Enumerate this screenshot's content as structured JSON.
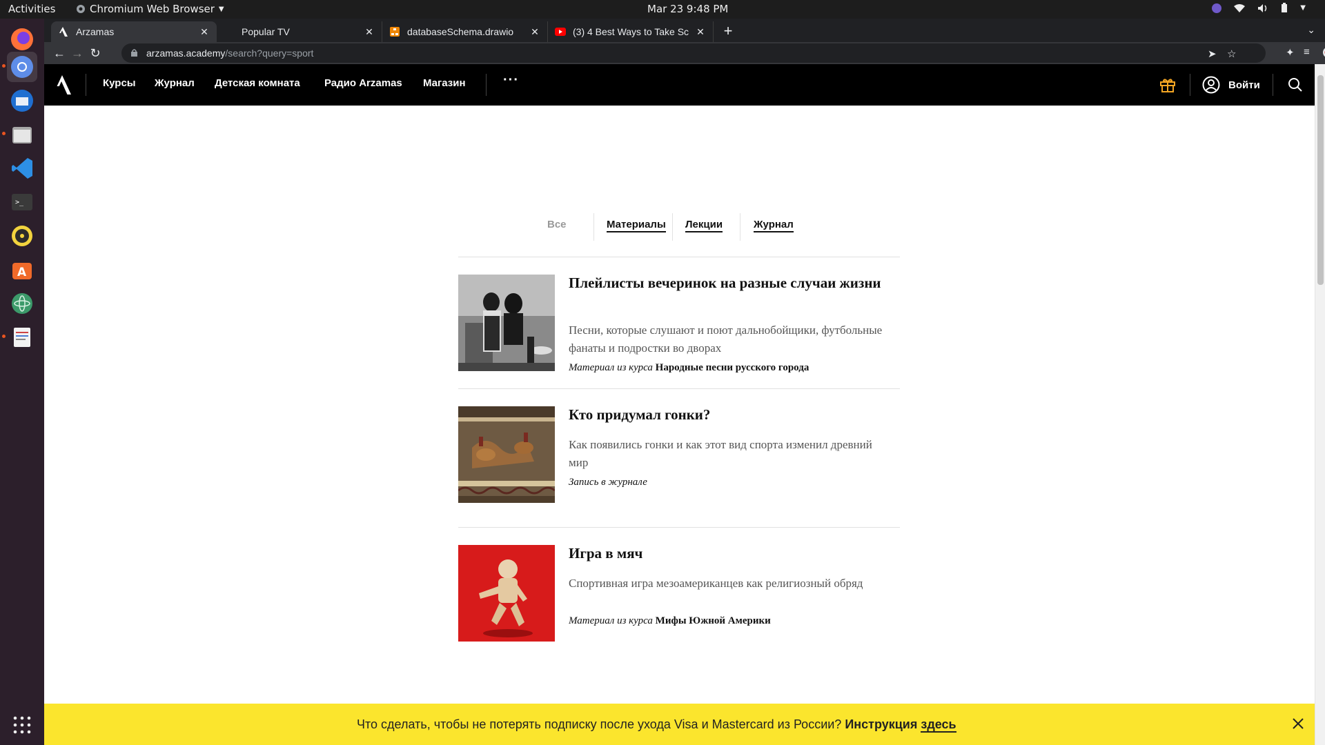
{
  "system": {
    "activities": "Activities",
    "app_name": "Chromium Web Browser",
    "clock": "Mar 23  9:48 PM"
  },
  "browser": {
    "tabs": [
      {
        "title": "Arzamas"
      },
      {
        "title": "Popular TV"
      },
      {
        "title": "databaseSchema.drawio"
      },
      {
        "title": "(3) 4 Best Ways to Take Sc"
      }
    ],
    "url": {
      "domain": "arzamas.academy",
      "path": "/search?query=sport"
    }
  },
  "site": {
    "nav": [
      "Курсы",
      "Журнал",
      "Детская комната",
      "Радио Arzamas",
      "Магазин"
    ],
    "more": "···",
    "login": "Войти"
  },
  "search": {
    "filters": [
      "Все",
      "Материалы",
      "Лекции",
      "Журнал"
    ],
    "results": [
      {
        "title": "Плейлисты вечеринок на разные случаи жизни",
        "desc": "Песни, которые слушают и поют дальнобойщики, футбольные фанаты и подростки во дворах",
        "meta_prefix": "Материал из курса",
        "meta_course": "Народные песни русского города"
      },
      {
        "title": "Кто придумал гонки?",
        "desc": "Как появились гонки и как этот вид спорта изменил древний мир",
        "meta_prefix": "Запись в журнале",
        "meta_course": ""
      },
      {
        "title": "Игра в мяч",
        "desc": "Спортивная игра мезоамериканцев как религиозный обряд",
        "meta_prefix": "Материал из курса",
        "meta_course": "Мифы Южной Америки"
      }
    ]
  },
  "banner": {
    "text": "Что сделать, чтобы не потерять подписку после ухода Visa и Mastercard из России?",
    "bold": "Инструкция",
    "link": "здесь"
  },
  "colors": {
    "banner_bg": "#fbe52d",
    "header_bg": "#000000",
    "gift_icon": "#f5a623"
  }
}
